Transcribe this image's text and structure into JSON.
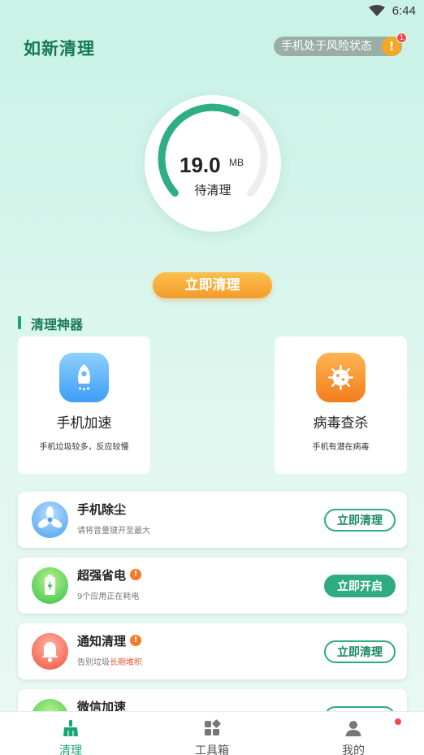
{
  "status_bar": {
    "time": "6:44"
  },
  "header": {
    "title": "如新清理",
    "risk_text": "手机处于风险状态",
    "risk_badge_count": "1"
  },
  "gauge": {
    "value": "19.0",
    "unit": "MB",
    "caption": "待清理",
    "progress": 0.6
  },
  "main_button": {
    "label": "立即清理"
  },
  "section": {
    "title": "清理神器"
  },
  "tools": [
    {
      "name": "手机加速",
      "desc": "手机垃圾较多，反应较慢",
      "icon": "rocket-icon"
    },
    {
      "name": "病毒查杀",
      "desc": "手机有潜在病毒",
      "icon": "virus-icon"
    }
  ],
  "list": [
    {
      "title": "手机除尘",
      "desc": "请将音量键开至最大",
      "button": "立即清理",
      "icon": "fan-icon"
    },
    {
      "title": "超强省电",
      "desc": "9个应用正在耗电",
      "button": "立即开启",
      "icon": "battery-icon",
      "alert": "!"
    },
    {
      "title": "通知清理",
      "desc_prefix": "告别垃圾",
      "desc_highlight": "长期堆积",
      "button": "立即清理",
      "icon": "bell-icon",
      "alert": "!"
    },
    {
      "title": "微信加速",
      "icon": "wechat-icon"
    }
  ],
  "bottom_nav": [
    {
      "label": "清理",
      "icon": "broom-icon",
      "active": true
    },
    {
      "label": "工具箱",
      "icon": "toolbox-icon"
    },
    {
      "label": "我的",
      "icon": "user-icon"
    }
  ],
  "colors": {
    "brand": "#1aa674",
    "accent_orange": "#f39a2a",
    "alert_red": "#f04b4b"
  }
}
